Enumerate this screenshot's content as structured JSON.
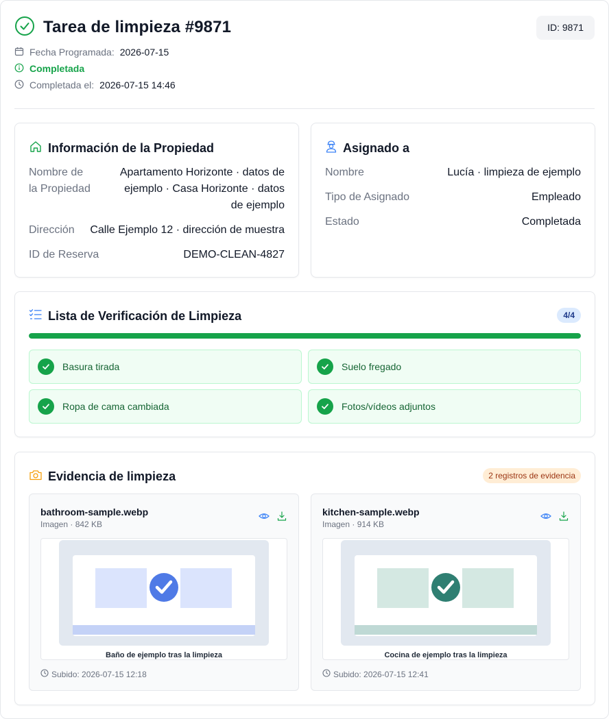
{
  "header": {
    "title": "Tarea de limpieza #9871",
    "id_badge": "ID: 9871",
    "scheduled_label": "Fecha Programada:",
    "scheduled_value": "2026-07-15",
    "status": "Completada",
    "completed_label": "Completada el:",
    "completed_value": "2026-07-15 14:46"
  },
  "property": {
    "title": "Información de la Propiedad",
    "rows": [
      {
        "label": "Nombre de la Propiedad",
        "value": "Apartamento Horizonte · datos de ejemplo · Casa Horizonte · datos de ejemplo"
      },
      {
        "label": "Dirección",
        "value": "Calle Ejemplo 12 · dirección de muestra"
      },
      {
        "label": "ID de Reserva",
        "value": "DEMO-CLEAN-4827"
      }
    ]
  },
  "assigned": {
    "title": "Asignado a",
    "rows": [
      {
        "label": "Nombre",
        "value": "Lucía · limpieza de ejemplo"
      },
      {
        "label": "Tipo de Asignado",
        "value": "Empleado"
      },
      {
        "label": "Estado",
        "value": "Completada"
      }
    ]
  },
  "checklist": {
    "title": "Lista de Verificación de Limpieza",
    "count": "4/4",
    "progress": 1.0,
    "items": [
      "Basura tirada",
      "Suelo fregado",
      "Ropa de cama cambiada",
      "Fotos/vídeos adjuntos"
    ]
  },
  "evidence": {
    "title": "Evidencia de limpieza",
    "count_label": "2 registros de evidencia",
    "files": [
      {
        "name": "bathroom-sample.webp",
        "meta": "Imagen · 842 KB",
        "caption": "Baño de ejemplo tras la limpieza",
        "uploaded": "Subido: 2026-07-15 12:18",
        "accent": "#4f7ae6",
        "tile": "#dbe4fd",
        "strip": "#c4d2f7"
      },
      {
        "name": "kitchen-sample.webp",
        "meta": "Imagen · 914 KB",
        "caption": "Cocina de ejemplo tras la limpieza",
        "uploaded": "Subido: 2026-07-15 12:41",
        "accent": "#2f7f72",
        "tile": "#d4e8e2",
        "strip": "#bfd9d5"
      }
    ]
  },
  "colors": {
    "success": "#16a34a",
    "accent_blue": "#3b82f6",
    "badge_orange": "#ffedd5"
  }
}
